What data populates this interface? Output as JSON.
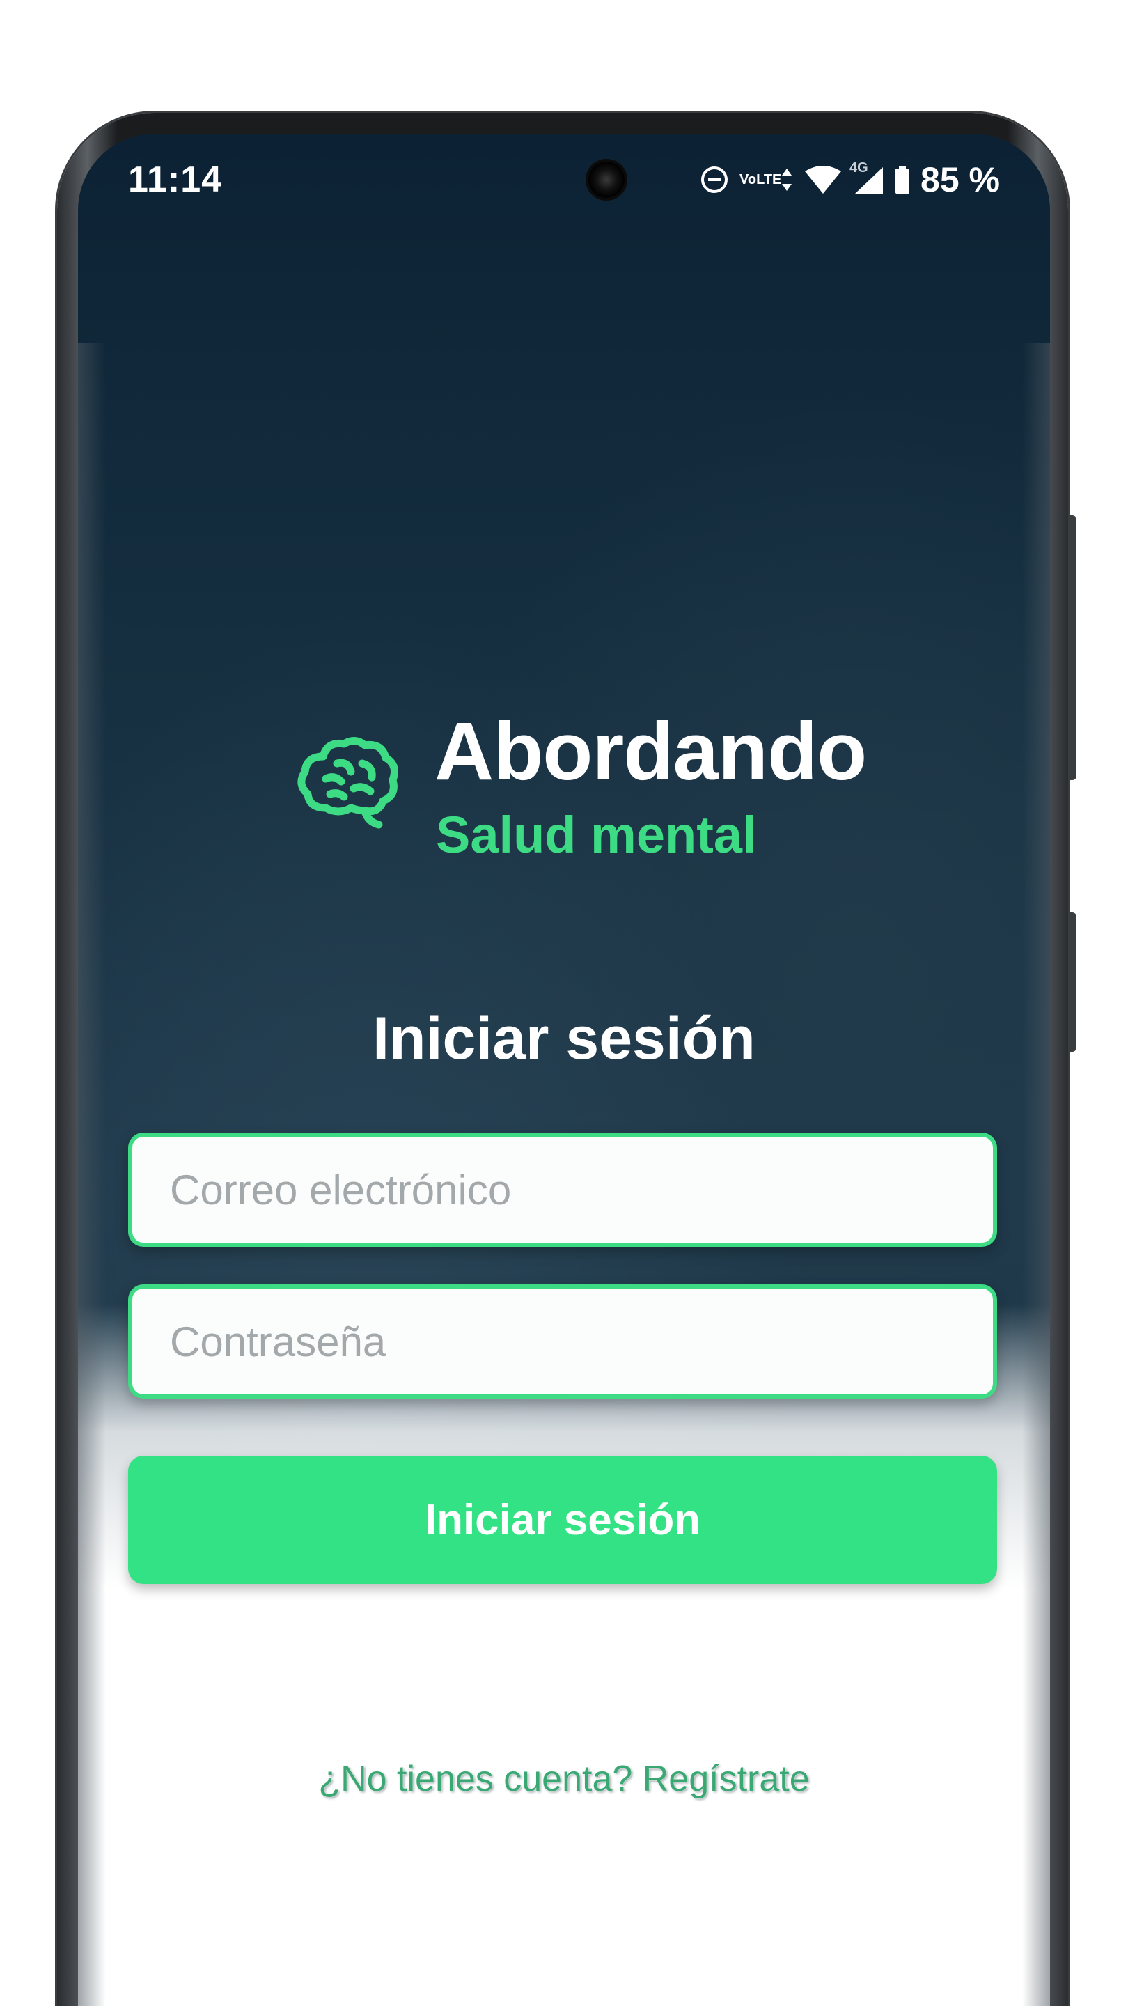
{
  "status_bar": {
    "time": "11:14",
    "volte_top": "Vo",
    "volte_bottom": "LTE",
    "network_type": "4G",
    "battery_percent": "85 %",
    "icons": [
      "do-not-disturb-icon",
      "volte-icon",
      "data-arrows-icon",
      "wifi-icon",
      "signal-icon",
      "battery-icon"
    ]
  },
  "brand": {
    "logo_icon": "brain-icon",
    "title": "Abordando",
    "subtitle": "Salud mental"
  },
  "login": {
    "title": "Iniciar sesión",
    "email_placeholder": "Correo electrónico",
    "email_value": "",
    "password_placeholder": "Contraseña",
    "password_value": "",
    "submit_label": "Iniciar sesión",
    "register_text": "¿No tienes cuenta? Regístrate"
  },
  "colors": {
    "accent": "#3ddc84",
    "button": "#33e285",
    "background_top": "#0c2234",
    "background_mid": "#1f3a4c"
  }
}
